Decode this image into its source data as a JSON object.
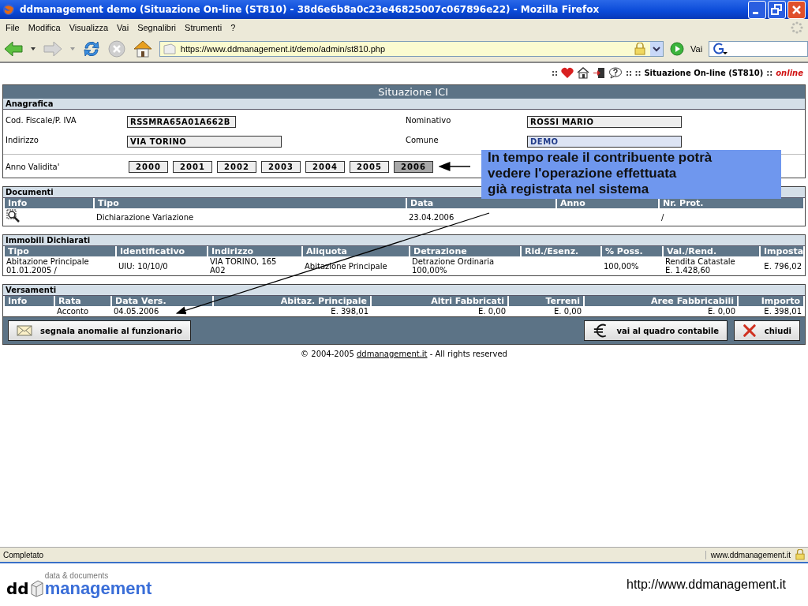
{
  "window": {
    "title": "ddmanagement demo (Situazione On-line (ST810) - 38d6e6b8a0c23e46825007c067896e22) - Mozilla Firefox"
  },
  "menu": [
    "File",
    "Modifica",
    "Visualizza",
    "Vai",
    "Segnalibri",
    "Strumenti",
    "?"
  ],
  "address_bar": {
    "url": "https://www.ddmanagement.it/demo/admin/st810.php",
    "go_label": "Vai"
  },
  "page_header": {
    "sep_left": "::",
    "sep_mid": ":: ::",
    "title": "Situazione On-line (ST810)",
    "sep_right": "::",
    "status": "online"
  },
  "panel_title": "Situazione ICI",
  "anagrafica": {
    "title": "Anagrafica",
    "fields": [
      {
        "label": "Cod. Fiscale/P. IVA",
        "value": "RSSMRA65A01A662B"
      },
      {
        "label": "Nominativo",
        "value": "ROSSI MARIO"
      },
      {
        "label": "Indirizzo",
        "value": "VIA TORINO"
      },
      {
        "label": "Comune",
        "value": "DEMO"
      }
    ],
    "year_label": "Anno Validita'",
    "years": [
      {
        "label": "2000",
        "selected": false
      },
      {
        "label": "2001",
        "selected": false
      },
      {
        "label": "2002",
        "selected": false
      },
      {
        "label": "2003",
        "selected": false
      },
      {
        "label": "2004",
        "selected": false
      },
      {
        "label": "2005",
        "selected": false
      },
      {
        "label": "2006",
        "selected": true
      }
    ]
  },
  "documenti": {
    "title": "Documenti",
    "columns": [
      {
        "label": "Info",
        "kind": "icon"
      },
      {
        "label": "Tipo"
      },
      {
        "label": "Data"
      },
      {
        "label": "Anno"
      },
      {
        "label": "Nr. Prot."
      }
    ],
    "rows": [
      {
        "cells": [
          null,
          "Dichiarazione Variazione",
          "23.04.2006",
          null,
          "/"
        ]
      }
    ]
  },
  "immobili": {
    "title": "Immobili Dichiarati",
    "columns": [
      {
        "label": "Tipo"
      },
      {
        "label": "Identificativo"
      },
      {
        "label": "Indirizzo"
      },
      {
        "label": "Aliquota"
      },
      {
        "label": "Detrazione"
      },
      {
        "label": "Rid./Esenz."
      },
      {
        "label": "% Poss."
      },
      {
        "label": "Val./Rend."
      },
      {
        "label": "Imposta"
      }
    ],
    "rows": [
      {
        "cells": [
          [
            "Abitazione Principale",
            "01.01.2005 /"
          ],
          [
            "UIU: 10/10/0"
          ],
          [
            "VIA TORINO, 165",
            "A02"
          ],
          [
            "Abitazione Principale"
          ],
          [
            "Detrazione Ordinaria",
            "100,00%"
          ],
          null,
          [
            "100,00%"
          ],
          [
            "Rendita Catastale",
            "E. 1.428,60"
          ],
          [
            "E. 796,02"
          ]
        ]
      }
    ]
  },
  "versamenti": {
    "title": "Versamenti",
    "columns": [
      {
        "label": "Info"
      },
      {
        "label": "Rata"
      },
      {
        "label": "Data Vers."
      },
      {
        "label": "Abitaz. Principale"
      },
      {
        "label": "Altri Fabbricati"
      },
      {
        "label": "Terreni"
      },
      {
        "label": "Aree Fabbricabili"
      },
      {
        "label": "Importo"
      }
    ],
    "rows": [
      {
        "cells": [
          null,
          "Acconto",
          "04.05.2006",
          "E. 398,01",
          "E. 0,00",
          "E. 0,00",
          "E. 0,00",
          "E. 398,01"
        ]
      }
    ]
  },
  "actions": [
    {
      "label": "segnala anomalie al funzionario",
      "kind": "mail"
    },
    {
      "label": "vai al quadro contabile",
      "kind": "euro"
    },
    {
      "label": "chiudi",
      "kind": "close"
    }
  ],
  "copyright": {
    "prefix": "© 2004-2005",
    "link": "ddmanagement.it",
    "suffix": "- All rights reserved"
  },
  "status_bar": {
    "text": "Completato",
    "site": "www.ddmanagement.it"
  },
  "callout": {
    "lines": [
      "In tempo reale il contribuente potrà",
      "vedere l'operazione effettuata",
      "già registrata nel sistema"
    ]
  },
  "slide_footer": {
    "logo_prefix": "dd",
    "logo_tagline": "data & documents",
    "logo_name": "management",
    "url": "http://www.ddmanagement.it"
  }
}
